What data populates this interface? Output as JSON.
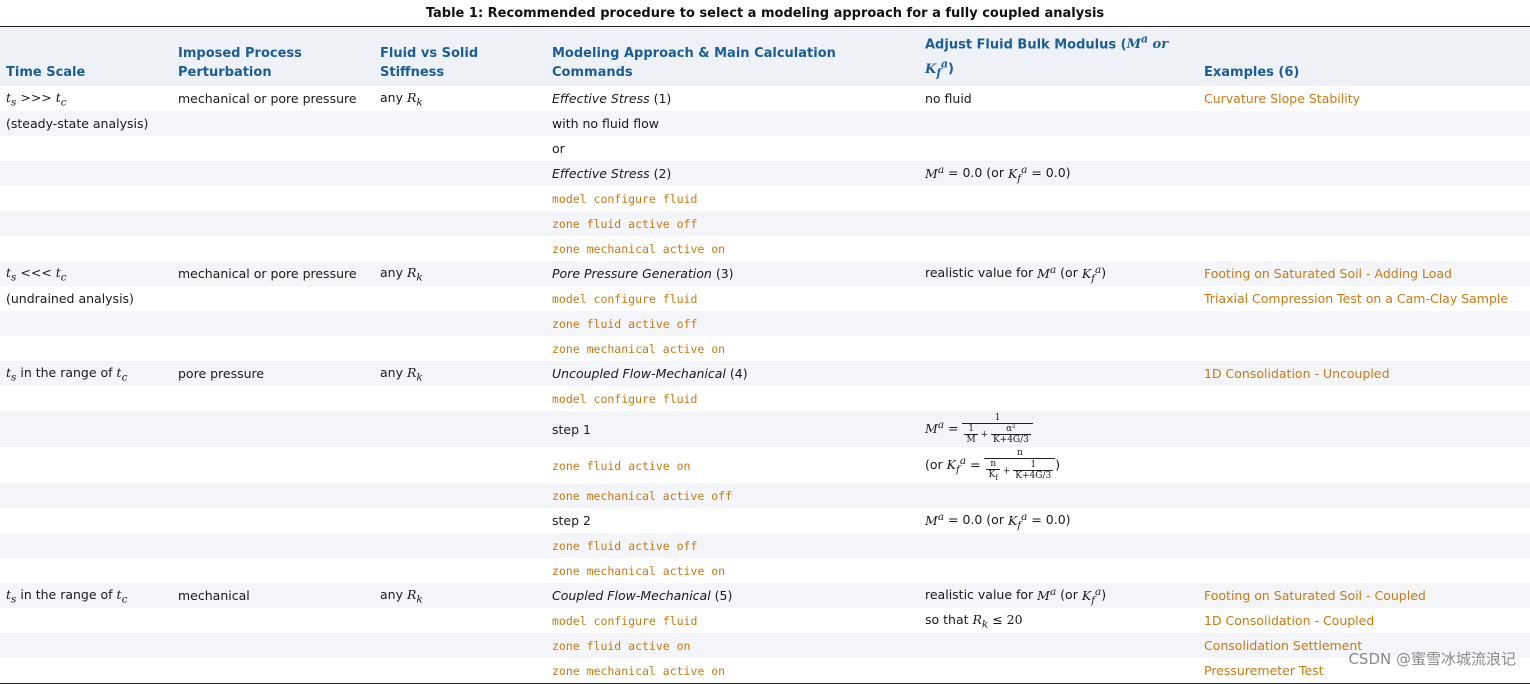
{
  "caption": "Table 1: Recommended procedure to select a modeling approach for a fully coupled analysis",
  "headers": {
    "time_scale": "Time Scale",
    "imposed": "Imposed Process Perturbation",
    "stiffness": "Fluid vs Solid Stiffness",
    "modeling": "Modeling Approach & Main Calculation Commands",
    "bulk_prefix": "Adjust Fluid Bulk Modulus (",
    "bulk_math": "Mᵃ or K_fᵃ",
    "bulk_suffix": ")",
    "examples": "Examples (6)"
  },
  "rows": [
    {
      "ts": "ts >>> tc",
      "imp": "mechanical or pore pressure",
      "stiff": "any Rk",
      "model_it": "Effective Stress",
      "model_tail": " (1)",
      "bulk": "no fluid",
      "ex": "Curvature Slope Stability"
    },
    {
      "ts": "(steady-state analysis)",
      "model": "with no fluid flow"
    },
    {
      "model": "or"
    },
    {
      "model_it": "Effective Stress",
      "model_tail": " (2)",
      "bulk": "Mᵃ = 0.0 (or K_fᵃ = 0.0)"
    },
    {
      "cmd": "model configure fluid"
    },
    {
      "cmd": "zone fluid active",
      "cmd_kw": "off"
    },
    {
      "cmd": "zone mechanical active",
      "cmd_kw": "on"
    },
    {
      "ts": "ts <<< tc",
      "imp": "mechanical or pore pressure",
      "stiff": "any Rk",
      "model_it": "Pore Pressure Generation",
      "model_tail": " (3)",
      "bulk": "realistic value for Mᵃ (or K_fᵃ)",
      "ex": "Footing on Saturated Soil - Adding Load"
    },
    {
      "ts": "(undrained analysis)",
      "cmd": "model configure fluid",
      "ex": "Triaxial Compression Test on a Cam-Clay Sample"
    },
    {
      "cmd": "zone fluid active",
      "cmd_kw": "off"
    },
    {
      "cmd": "zone mechanical active",
      "cmd_kw": "on"
    },
    {
      "ts": "ts in the range of tc",
      "imp": "pore pressure",
      "stiff": "any Rk",
      "model_it": "Uncoupled Flow-Mechanical",
      "model_tail": " (4)",
      "ex": "1D Consolidation - Uncoupled"
    },
    {
      "cmd": "model configure fluid"
    },
    {
      "model": "step 1",
      "bulk": "Mᵃ = 1 / (1/M + α²/(K+4G/3))"
    },
    {
      "cmd": "zone fluid active",
      "cmd_kw": "on",
      "bulk": "(or K_fᵃ = n / (n/K_f + 1/(K+4G/3)))"
    },
    {
      "cmd": "zone mechanical active",
      "cmd_kw": "off"
    },
    {
      "model": "step 2",
      "bulk": "Mᵃ = 0.0 (or K_fᵃ = 0.0)"
    },
    {
      "cmd": "zone fluid active",
      "cmd_kw": "off"
    },
    {
      "cmd": "zone mechanical active",
      "cmd_kw": "on"
    },
    {
      "ts": "ts in the range of tc",
      "imp": "mechanical",
      "stiff": "any Rk",
      "model_it": "Coupled Flow-Mechanical",
      "model_tail": " (5)",
      "bulk": "realistic value for Mᵃ (or K_fᵃ)",
      "ex": "Footing on Saturated Soil - Coupled"
    },
    {
      "cmd": "model configure fluid",
      "bulk": "so that Rk ≤ 20",
      "ex": "1D Consolidation - Coupled"
    },
    {
      "cmd": "zone fluid active",
      "cmd_kw": "on",
      "ex": "Consolidation Settlement"
    },
    {
      "cmd": "zone mechanical active",
      "cmd_kw": "on",
      "ex": "Pressuremeter Test"
    }
  ],
  "watermark": "CSDN @蜜雪冰城流浪记",
  "colors": {
    "header_text": "#1b5e97",
    "command": "#c77a12",
    "keyword": "#2e8b2e",
    "link": "#c77a12",
    "row_stripe": "#f3f5f9"
  }
}
